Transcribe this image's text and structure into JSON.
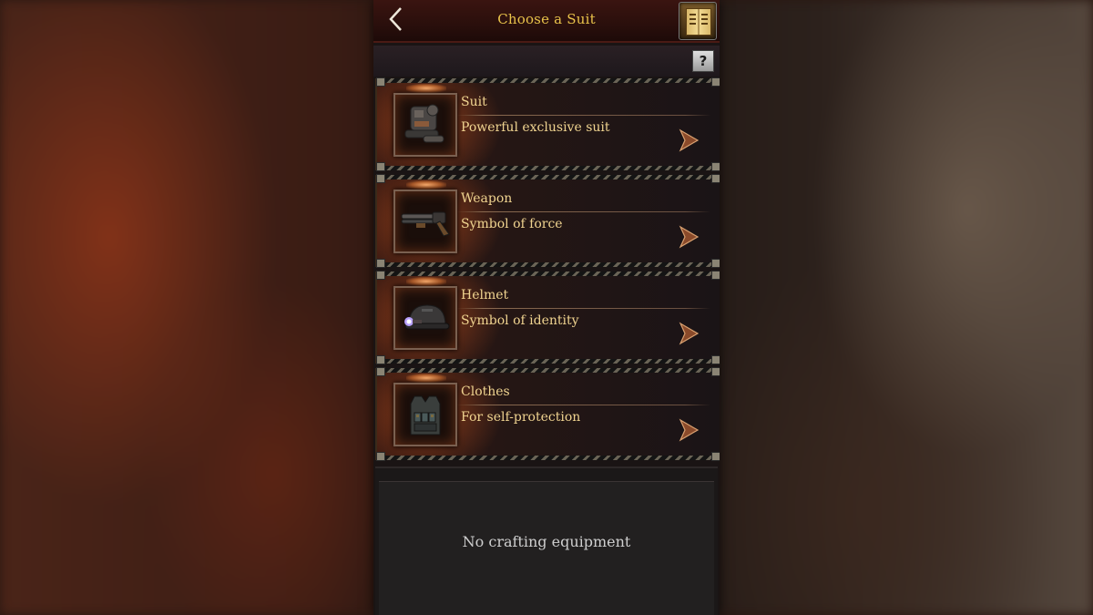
{
  "header": {
    "back_icon": "chevron-left-icon",
    "title": "Choose a Suit",
    "book_icon": "book-icon"
  },
  "help": {
    "label": "?"
  },
  "categories": [
    {
      "name": "Suit",
      "description": "Powerful exclusive suit",
      "icon": "armor-suit-icon"
    },
    {
      "name": "Weapon",
      "description": "Symbol of force",
      "icon": "shotgun-icon"
    },
    {
      "name": "Helmet",
      "description": "Symbol of identity",
      "icon": "helmet-icon"
    },
    {
      "name": "Clothes",
      "description": "For self-protection",
      "icon": "vest-icon"
    }
  ],
  "crafting": {
    "empty_text": "No crafting equipment"
  },
  "colors": {
    "title": "#e8c24a",
    "label": "#f0d490",
    "accent_glow": "#ffb070"
  }
}
